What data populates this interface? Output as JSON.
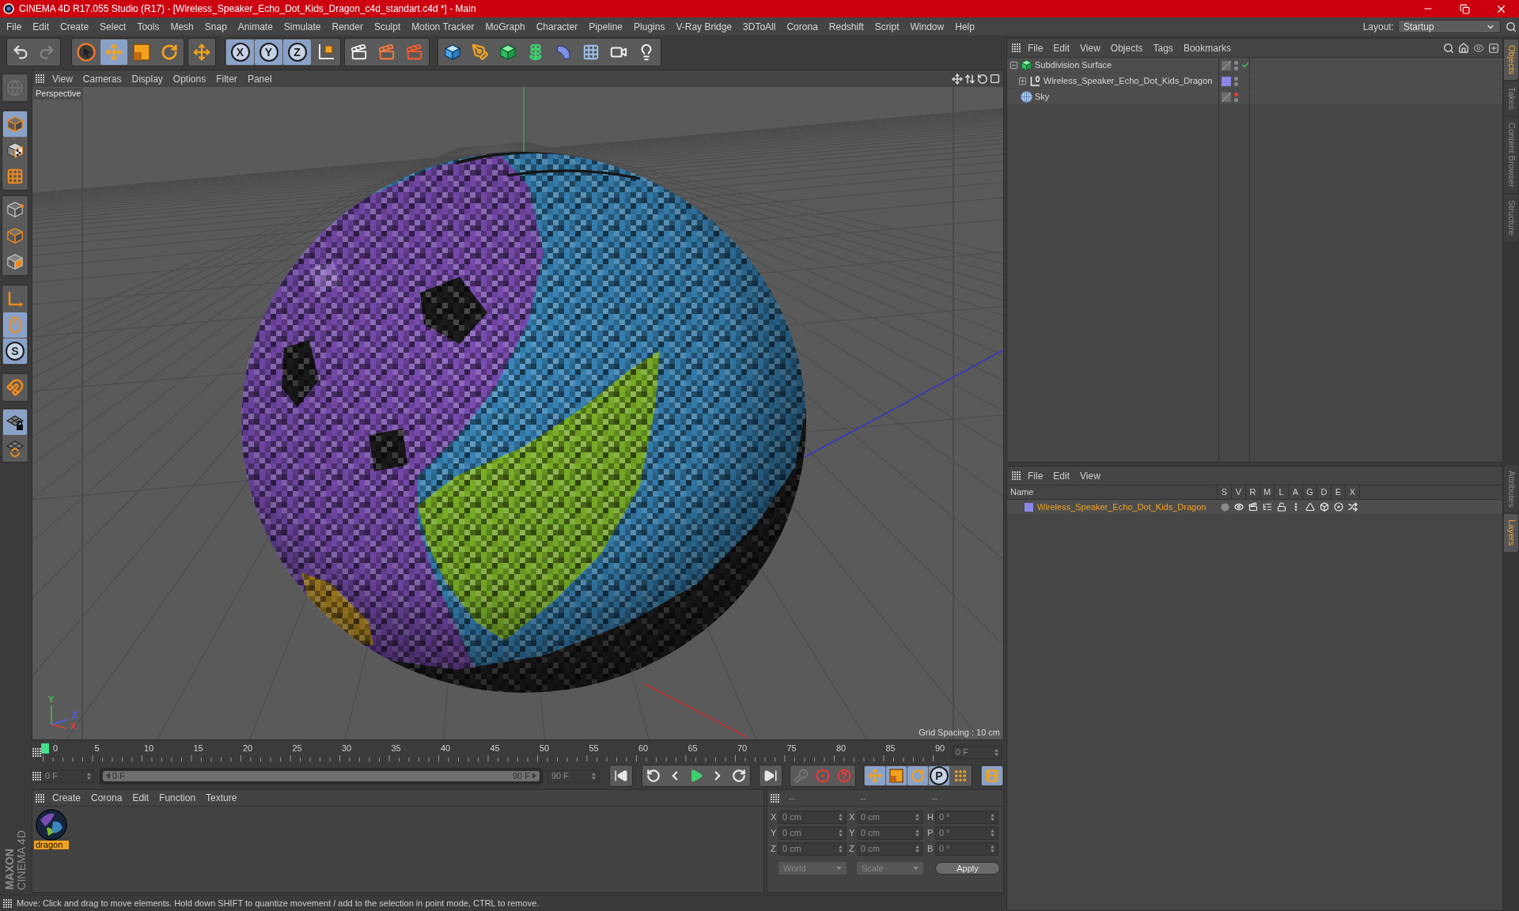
{
  "window": {
    "title": "CINEMA 4D R17.055 Studio (R17) - [Wireless_Speaker_Echo_Dot_Kids_Dragon_c4d_standart.c4d *] - Main"
  },
  "menu_bar": {
    "items": [
      "File",
      "Edit",
      "Create",
      "Select",
      "Tools",
      "Mesh",
      "Snap",
      "Animate",
      "Simulate",
      "Render",
      "Sculpt",
      "Motion Tracker",
      "MoGraph",
      "Character",
      "Pipeline",
      "Plugins",
      "V-Ray Bridge",
      "3DToAll",
      "Corona",
      "Redshift",
      "Script",
      "Window",
      "Help"
    ],
    "layout_label": "Layout:",
    "layout_value": "Startup"
  },
  "main_toolbar": [
    {
      "active": false,
      "disabled": false
    },
    {
      "active": false,
      "disabled": true
    },
    {
      "active": false,
      "disabled": false
    },
    {
      "active": true,
      "disabled": false
    },
    {
      "active": false,
      "disabled": false
    },
    {
      "active": false,
      "disabled": false
    },
    {
      "active": false,
      "disabled": false
    },
    {
      "active": true,
      "disabled": false,
      "label": "X"
    },
    {
      "active": true,
      "disabled": false,
      "label": "Y"
    },
    {
      "active": true,
      "disabled": false,
      "label": "Z"
    },
    {
      "active": false,
      "disabled": false
    },
    {
      "active": false,
      "disabled": false
    },
    {
      "active": false,
      "disabled": false
    },
    {
      "active": false,
      "disabled": false
    },
    {
      "active": false,
      "disabled": false
    },
    {
      "active": false,
      "disabled": false
    },
    {
      "active": false,
      "disabled": false
    },
    {
      "active": false,
      "disabled": false
    },
    {
      "active": false,
      "disabled": false
    },
    {
      "active": false,
      "disabled": false
    },
    {
      "active": false,
      "disabled": false
    },
    {
      "active": false,
      "disabled": false
    }
  ],
  "left_toolbar": [
    {
      "active": false,
      "disabled": true
    },
    {
      "active": true,
      "disabled": false
    },
    {
      "active": false,
      "disabled": false
    },
    {
      "active": false,
      "disabled": false
    },
    {
      "active": false,
      "disabled": false
    },
    {
      "active": false,
      "disabled": false
    },
    {
      "active": false,
      "disabled": false
    },
    {
      "active": false,
      "disabled": false
    },
    {
      "active": true,
      "disabled": false
    },
    {
      "active": true,
      "disabled": false,
      "label": "S"
    },
    {
      "active": false,
      "disabled": false
    },
    {
      "active": true,
      "disabled": false
    },
    {
      "active": false,
      "disabled": false
    }
  ],
  "viewport": {
    "menu": [
      "View",
      "Cameras",
      "Display",
      "Options",
      "Filter",
      "Panel"
    ],
    "camera": "Perspective",
    "grid_spacing": "Grid Spacing : 10 cm",
    "axis_labels": [
      {
        "label": "Y",
        "color": "#3fc34a"
      },
      {
        "label": "Z",
        "color": "#4a5cff"
      },
      {
        "label": "X",
        "color": "#e0403a"
      }
    ]
  },
  "timeline": {
    "ticks": [
      "0",
      "5",
      "10",
      "15",
      "20",
      "25",
      "30",
      "35",
      "40",
      "45",
      "50",
      "55",
      "60",
      "65",
      "70",
      "75",
      "80",
      "85",
      "90"
    ],
    "level": 0,
    "current_frame": "0 F"
  },
  "playback": {
    "start_field": "0 F",
    "range": {
      "start": "0 F",
      "end": "90 F",
      "level": 1
    },
    "end_field": "90 F",
    "buttons": [
      {
        "active": false,
        "disabled": false
      },
      {
        "active": false,
        "disabled": false
      },
      {
        "active": false,
        "disabled": false
      },
      {
        "active": false,
        "disabled": false
      },
      {
        "active": false,
        "disabled": false
      },
      {
        "active": false,
        "disabled": false
      },
      {
        "active": false,
        "disabled": false
      },
      {
        "active": false,
        "disabled": true
      },
      {
        "active": false,
        "disabled": false
      },
      {
        "active": false,
        "disabled": false
      },
      {
        "active": true,
        "disabled": false
      },
      {
        "active": true,
        "disabled": false
      },
      {
        "active": true,
        "disabled": false
      },
      {
        "active": true,
        "disabled": false,
        "label": "P"
      },
      {
        "active": false,
        "disabled": false
      },
      {
        "active": true,
        "disabled": false
      }
    ]
  },
  "material_manager": {
    "menu": [
      "Create",
      "Corona",
      "Edit",
      "Function",
      "Texture"
    ],
    "materials": [
      {
        "name": "dragon",
        "selected": true
      }
    ]
  },
  "coordinates": {
    "headers": [
      "--",
      "--",
      "--"
    ],
    "rows": [
      {
        "position_axis": "X",
        "position": "0 cm",
        "size_axis": "X",
        "size": "0 cm",
        "rotation_axis": "H",
        "rotation": "0 °"
      },
      {
        "position_axis": "Y",
        "position": "0 cm",
        "size_axis": "Y",
        "size": "0 cm",
        "rotation_axis": "P",
        "rotation": "0 °"
      },
      {
        "position_axis": "Z",
        "position": "0 cm",
        "size_axis": "Z",
        "size": "0 cm",
        "rotation_axis": "B",
        "rotation": "0 °"
      }
    ],
    "coordinate_mode": "World",
    "size_mode": "Scale",
    "apply": "Apply"
  },
  "status_bar": {
    "text": "Move: Click and drag to move elements. Hold down SHIFT to quantize movement / add to the selection in point mode, CTRL to remove."
  },
  "object_manager": {
    "menu": [
      "File",
      "Edit",
      "View",
      "Objects",
      "Tags",
      "Bookmarks"
    ],
    "objects": [
      {
        "kind": "subdivision",
        "name": "Subdivision Surface",
        "expanded": true,
        "editor_hidden": false,
        "render_hidden": false,
        "enabled": true,
        "children": [
          {
            "kind": "null",
            "name": "Wireless_Speaker_Echo_Dot_Kids_Dragon",
            "expanded": false,
            "color": "#8b87e6",
            "editor_hidden": false,
            "render_hidden": false
          }
        ]
      },
      {
        "kind": "sky",
        "name": "Sky",
        "editor_hidden": true,
        "render_hidden": false
      }
    ]
  },
  "layer_manager": {
    "menu": [
      "File",
      "Edit",
      "View"
    ],
    "columns": [
      "Name",
      "S",
      "V",
      "R",
      "M",
      "L",
      "A",
      "G",
      "D",
      "E",
      "X"
    ],
    "layers": [
      {
        "name": "Wireless_Speaker_Echo_Dot_Kids_Dragon",
        "color": "#8b87e6",
        "selected": true
      }
    ]
  },
  "side_tabs": {
    "upper": [
      {
        "label": "Objects",
        "selected": true
      },
      {
        "label": "Takes",
        "selected": false
      },
      {
        "label": "Content Browser",
        "selected": false
      },
      {
        "label": "Structure",
        "selected": false
      }
    ],
    "lower": [
      {
        "label": "Attributes",
        "selected": false
      },
      {
        "label": "Layers",
        "selected": true
      }
    ]
  },
  "logo": {
    "brand": "MAXON",
    "product": "CINEMA 4D"
  }
}
